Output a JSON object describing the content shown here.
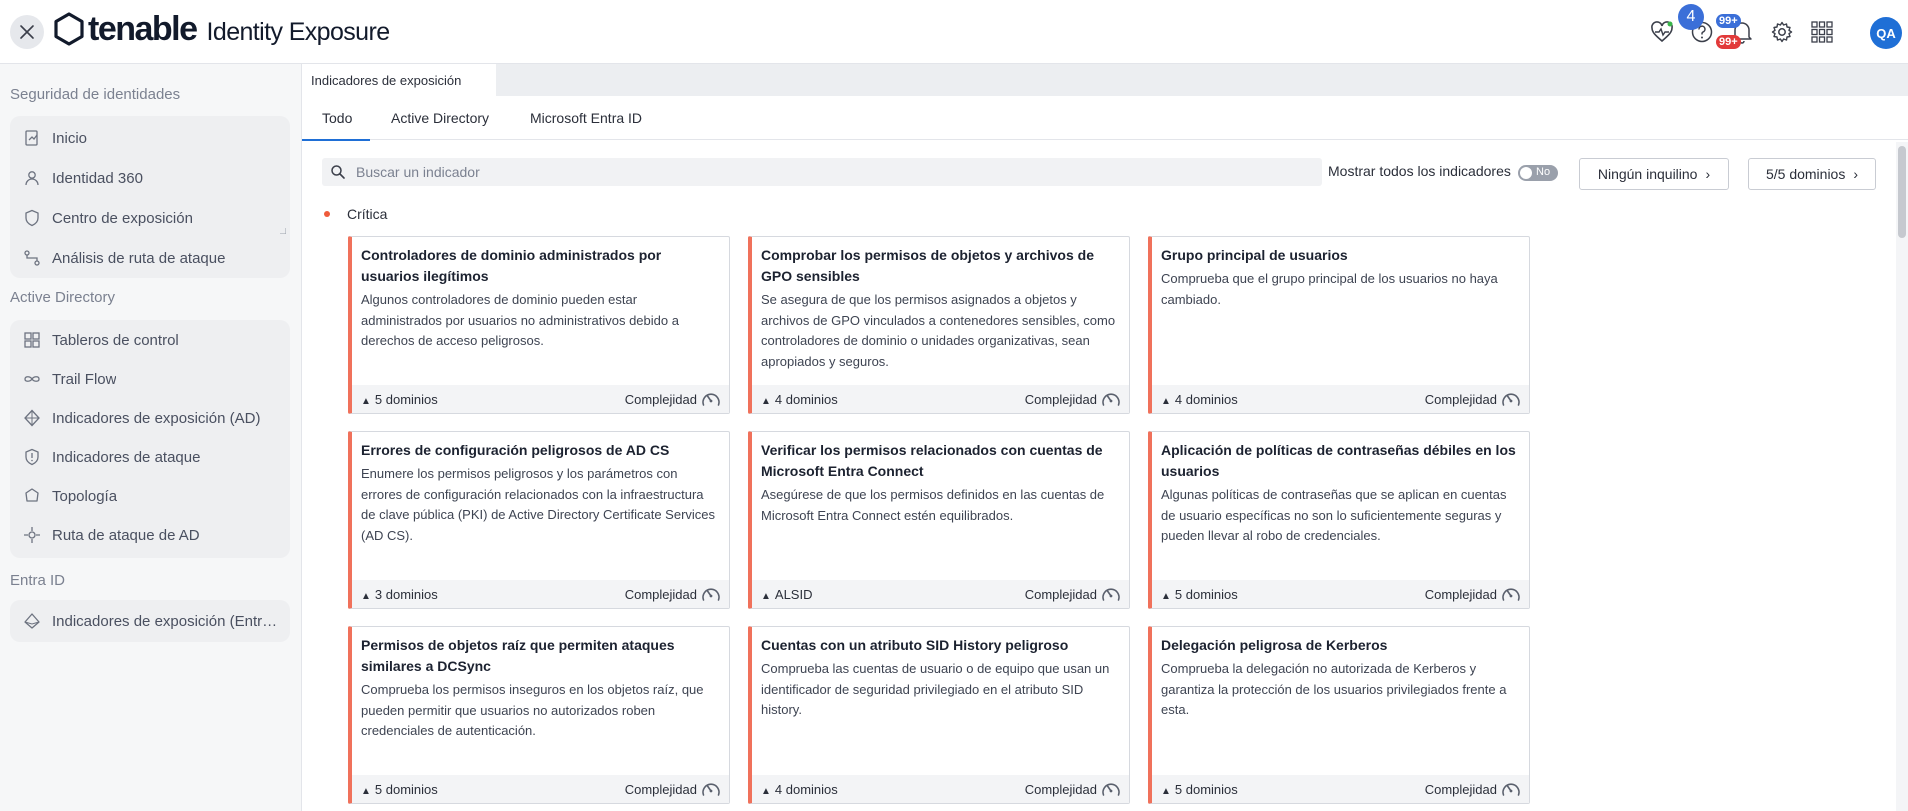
{
  "header": {
    "brand": "tenable",
    "product": "Identity Exposure",
    "help_badge": "4",
    "notif_badge_top": "99+",
    "notif_badge_bottom": "99+",
    "avatar": "QA",
    "icons": [
      "close-icon",
      "health-icon",
      "help-icon",
      "bell-icon",
      "gear-icon",
      "apps-grid-icon"
    ],
    "colors": {
      "avatar": "#1f6fd6",
      "badge_blue": "#3b6fd8",
      "badge_red": "#e23a3a"
    }
  },
  "sidebar": {
    "sections": [
      {
        "title": "Seguridad de identidades",
        "items": [
          {
            "label": "Inicio",
            "icon": "home-icon"
          },
          {
            "label": "Identidad 360",
            "icon": "user-icon"
          },
          {
            "label": "Centro de exposición",
            "icon": "shield-icon"
          },
          {
            "label": "Análisis de ruta de ataque",
            "icon": "route-icon"
          }
        ]
      },
      {
        "title": "Active Directory",
        "items": [
          {
            "label": "Tableros de control",
            "icon": "grid-icon"
          },
          {
            "label": "Trail Flow",
            "icon": "infinity-icon"
          },
          {
            "label": "Indicadores de exposición (AD)",
            "icon": "ioe-icon"
          },
          {
            "label": "Indicadores de ataque",
            "icon": "shield-alert-icon"
          },
          {
            "label": "Topología",
            "icon": "topology-icon"
          },
          {
            "label": "Ruta de ataque de AD",
            "icon": "target-icon"
          }
        ]
      },
      {
        "title": "Entra ID",
        "items": [
          {
            "label": "Indicadores de exposición (Entra ID)",
            "icon": "entra-icon"
          }
        ]
      }
    ]
  },
  "main": {
    "page_tab": "Indicadores de exposición",
    "subtabs": [
      "Todo",
      "Active Directory",
      "Microsoft Entra ID"
    ],
    "active_subtab": "Todo",
    "search_placeholder": "Buscar un indicador",
    "show_all_label": "Mostrar todos los indicadores",
    "toggle_label": "No",
    "tenant_button": "Ningún inquilino",
    "domains_button": "5/5 dominios",
    "severity_label": "Crítica",
    "severity_color": "#ef5b3b",
    "complexity_label": "Complejidad",
    "cards": [
      {
        "title": "Controladores de dominio administrados por usuarios ilegítimos",
        "desc": "Algunos controladores de dominio pueden estar administrados por usuarios no administrativos debido a derechos de acceso peligrosos.",
        "domains": "5 dominios"
      },
      {
        "title": "Comprobar los permisos de objetos y archivos de GPO sensibles",
        "desc": "Se asegura de que los permisos asignados a objetos y archivos de GPO vinculados a contenedores sensibles, como controladores de dominio o unidades organizativas, sean apropiados y seguros.",
        "domains": "4 dominios"
      },
      {
        "title": "Grupo principal de usuarios",
        "desc": "Comprueba que el grupo principal de los usuarios no haya cambiado.",
        "domains": "4 dominios"
      },
      {
        "title": "Errores de configuración peligrosos de AD CS",
        "desc": "Enumere los permisos peligrosos y los parámetros con errores de configuración relacionados con la infraestructura de clave pública (PKI) de Active Directory Certificate Services (AD CS).",
        "domains": "3 dominios"
      },
      {
        "title": "Verificar los permisos relacionados con cuentas de Microsoft Entra Connect",
        "desc": "Asegúrese de que los permisos definidos en las cuentas de Microsoft Entra Connect estén equilibrados.",
        "domains": "ALSID"
      },
      {
        "title": "Aplicación de políticas de contraseñas débiles en los usuarios",
        "desc": "Algunas políticas de contraseñas que se aplican en cuentas de usuario específicas no son lo suficientemente seguras y pueden llevar al robo de credenciales.",
        "domains": "5 dominios"
      },
      {
        "title": "Permisos de objetos raíz que permiten ataques similares a DCSync",
        "desc": "Comprueba los permisos inseguros en los objetos raíz, que pueden permitir que usuarios no autorizados roben credenciales de autenticación.",
        "domains": "5 dominios"
      },
      {
        "title": "Cuentas con un atributo SID History peligroso",
        "desc": "Comprueba las cuentas de usuario o de equipo que usan un identificador de seguridad privilegiado en el atributo SID history.",
        "domains": "4 dominios"
      },
      {
        "title": "Delegación peligrosa de Kerberos",
        "desc": "Comprueba la delegación no autorizada de Kerberos y garantiza la protección de los usuarios privilegiados frente a esta.",
        "domains": "5 dominios"
      }
    ]
  }
}
